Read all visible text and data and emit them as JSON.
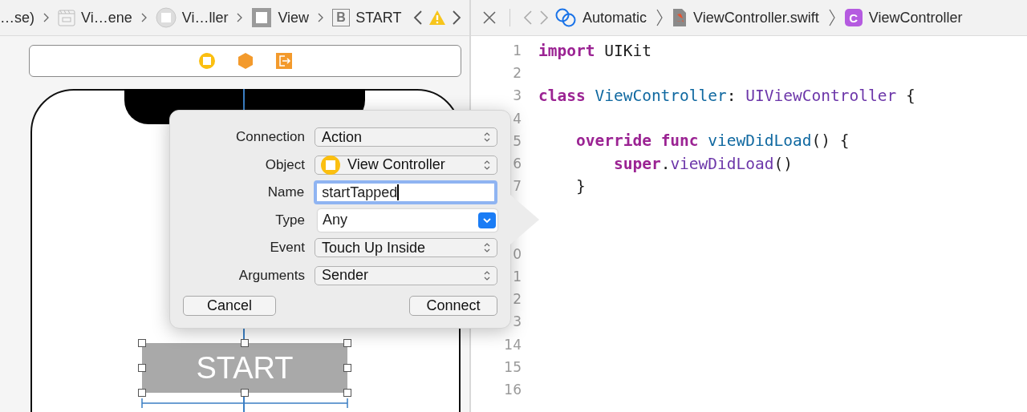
{
  "jump_bar": {
    "items": [
      {
        "label": "…se)",
        "kind": "none"
      },
      {
        "label": "Vi…ene",
        "kind": "scene"
      },
      {
        "label": "Vi…ller",
        "kind": "controller"
      },
      {
        "label": "View",
        "kind": "view"
      },
      {
        "label": "START",
        "kind": "button",
        "glyph": "B"
      }
    ]
  },
  "editor_bar": {
    "items": [
      {
        "label": "Automatic",
        "kind": "related"
      },
      {
        "label": "ViewController.swift",
        "kind": "swift"
      },
      {
        "label": "ViewController",
        "kind": "class",
        "glyph": "C"
      }
    ]
  },
  "canvas": {
    "button_title": "START"
  },
  "popover": {
    "rows": [
      {
        "label": "Connection",
        "kind": "select",
        "value": "Action"
      },
      {
        "label": "Object",
        "kind": "object",
        "value": "View Controller"
      },
      {
        "label": "Name",
        "kind": "text",
        "value": "startTapped",
        "focused": true
      },
      {
        "label": "Type",
        "kind": "combo",
        "value": "Any"
      },
      {
        "label": "Event",
        "kind": "select",
        "value": "Touch Up Inside"
      },
      {
        "label": "Arguments",
        "kind": "select",
        "value": "Sender"
      }
    ],
    "buttons": [
      "Cancel",
      "Connect"
    ]
  },
  "code": {
    "lines": [
      {
        "number": "1",
        "tokens": [
          {
            "text": "import",
            "kind": "keyword"
          },
          {
            "text": " UIKit",
            "kind": "plain"
          }
        ]
      },
      {
        "number": "2"
      },
      {
        "number": "3",
        "tokens": [
          {
            "text": "class",
            "kind": "keyword"
          },
          {
            "text": " ViewController",
            "kind": "declaration"
          },
          {
            "text": ": ",
            "kind": "plain"
          },
          {
            "text": "UIViewController",
            "kind": "system"
          },
          {
            "text": " {",
            "kind": "plain"
          }
        ]
      },
      {
        "number": "4"
      },
      {
        "number": "5",
        "tokens": [
          {
            "text": "    override",
            "kind": "keyword"
          },
          {
            "text": " func",
            "kind": "keyword"
          },
          {
            "text": " viewDidLoad",
            "kind": "declaration"
          },
          {
            "text": "() {",
            "kind": "plain"
          }
        ]
      },
      {
        "number": "6",
        "tokens": [
          {
            "text": "        super",
            "kind": "keyword"
          },
          {
            "text": ".",
            "kind": "plain"
          },
          {
            "text": "viewDidLoad",
            "kind": "system"
          },
          {
            "text": "()",
            "kind": "plain"
          }
        ]
      },
      {
        "number": "7",
        "tokens": [
          {
            "text": "    }",
            "kind": "plain"
          }
        ]
      }
    ],
    "lower_lines": [
      {
        "number": "0"
      },
      {
        "number": "1"
      },
      {
        "number": "2"
      },
      {
        "number": "3"
      },
      {
        "number": "14"
      },
      {
        "number": "15"
      },
      {
        "number": "16"
      }
    ]
  }
}
